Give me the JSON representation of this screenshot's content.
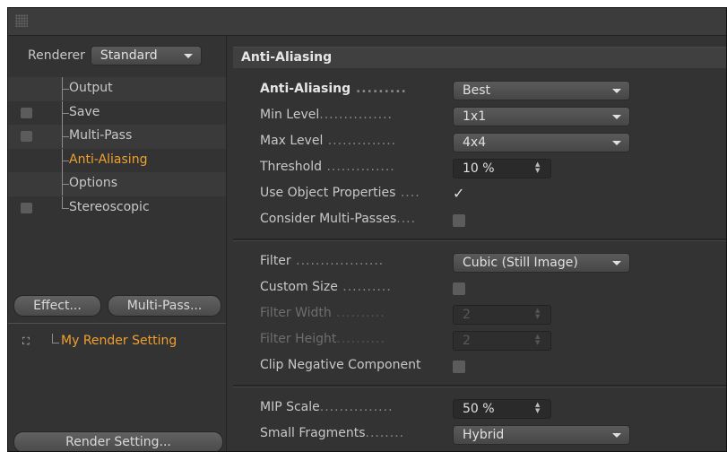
{
  "left": {
    "renderer_label": "Renderer",
    "renderer_value": "Standard",
    "tree": [
      {
        "label": "Output",
        "checkbox": false,
        "active": false
      },
      {
        "label": "Save",
        "checkbox": true,
        "active": false
      },
      {
        "label": "Multi-Pass",
        "checkbox": true,
        "active": false
      },
      {
        "label": "Anti-Aliasing",
        "checkbox": false,
        "active": true
      },
      {
        "label": "Options",
        "checkbox": false,
        "active": false
      },
      {
        "label": "Stereoscopic",
        "checkbox": true,
        "active": false
      }
    ],
    "effect_button": "Effect...",
    "multipass_button": "Multi-Pass...",
    "render_setting_name": "My Render Setting",
    "render_setting_button": "Render Setting..."
  },
  "right": {
    "section_title": "Anti-Aliasing",
    "rows": {
      "anti_aliasing": {
        "label": "Anti-Aliasing",
        "value": "Best"
      },
      "min_level": {
        "label": "Min Level",
        "value": "1x1"
      },
      "max_level": {
        "label": "Max Level",
        "value": "4x4"
      },
      "threshold": {
        "label": "Threshold",
        "value": "10 %"
      },
      "use_object_props": {
        "label": "Use Object Properties",
        "checked": true
      },
      "consider_multipasses": {
        "label": "Consider Multi-Passes",
        "checked": false
      },
      "filter": {
        "label": "Filter",
        "value": "Cubic (Still Image)"
      },
      "custom_size": {
        "label": "Custom Size",
        "checked": false
      },
      "filter_width": {
        "label": "Filter Width",
        "value": "2"
      },
      "filter_height": {
        "label": "Filter Height",
        "value": "2"
      },
      "clip_negative": {
        "label": "Clip Negative Component",
        "checked": false
      },
      "mip_scale": {
        "label": "MIP Scale",
        "value": "50 %"
      },
      "small_fragments": {
        "label": "Small Fragments",
        "value": "Hybrid"
      }
    }
  },
  "colors": {
    "accent": "#f0a030",
    "panel": "#333333",
    "text": "#c8c8c8"
  }
}
